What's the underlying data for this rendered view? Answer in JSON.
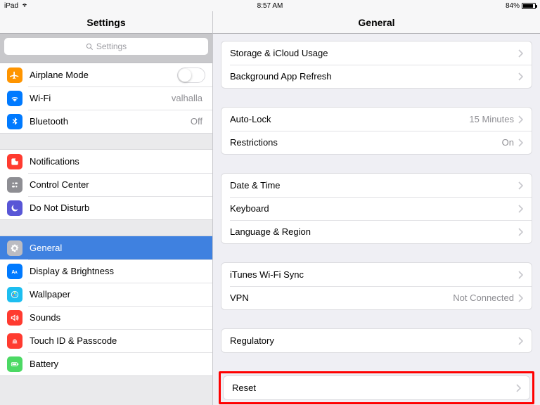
{
  "statusbar": {
    "carrier": "iPad",
    "time": "8:57 AM",
    "battery_pct": "84%"
  },
  "sidebar": {
    "title": "Settings",
    "search_placeholder": "Settings",
    "groups": [
      {
        "rows": [
          {
            "icon": "airplane-icon",
            "bg": "bg-orange",
            "label": "Airplane Mode",
            "accessory": "toggle",
            "toggle_on": false
          },
          {
            "icon": "wifi-icon",
            "bg": "bg-blue",
            "label": "Wi-Fi",
            "value": "valhalla"
          },
          {
            "icon": "bluetooth-icon",
            "bg": "bg-blue",
            "label": "Bluetooth",
            "value": "Off"
          }
        ]
      },
      {
        "rows": [
          {
            "icon": "notifications-icon",
            "bg": "bg-red",
            "label": "Notifications"
          },
          {
            "icon": "control-center-icon",
            "bg": "bg-grey",
            "label": "Control Center"
          },
          {
            "icon": "dnd-icon",
            "bg": "bg-purple",
            "label": "Do Not Disturb"
          }
        ]
      },
      {
        "rows": [
          {
            "icon": "gear-icon",
            "bg": "bg-selgrey",
            "label": "General",
            "selected": true
          },
          {
            "icon": "display-icon",
            "bg": "bg-blue",
            "label": "Display & Brightness"
          },
          {
            "icon": "wallpaper-icon",
            "bg": "bg-cyan",
            "label": "Wallpaper"
          },
          {
            "icon": "sounds-icon",
            "bg": "bg-red",
            "label": "Sounds"
          },
          {
            "icon": "touchid-icon",
            "bg": "bg-red",
            "label": "Touch ID & Passcode"
          },
          {
            "icon": "battery-icon",
            "bg": "bg-green",
            "label": "Battery"
          }
        ]
      }
    ]
  },
  "detail": {
    "title": "General",
    "groups": [
      {
        "rows": [
          {
            "label": "Storage & iCloud Usage"
          },
          {
            "label": "Background App Refresh"
          }
        ]
      },
      {
        "rows": [
          {
            "label": "Auto-Lock",
            "value": "15 Minutes"
          },
          {
            "label": "Restrictions",
            "value": "On"
          }
        ]
      },
      {
        "rows": [
          {
            "label": "Date & Time"
          },
          {
            "label": "Keyboard"
          },
          {
            "label": "Language & Region"
          }
        ]
      },
      {
        "rows": [
          {
            "label": "iTunes Wi-Fi Sync"
          },
          {
            "label": "VPN",
            "value": "Not Connected"
          }
        ]
      },
      {
        "rows": [
          {
            "label": "Regulatory"
          }
        ]
      },
      {
        "highlighted": true,
        "rows": [
          {
            "label": "Reset"
          }
        ]
      }
    ]
  }
}
